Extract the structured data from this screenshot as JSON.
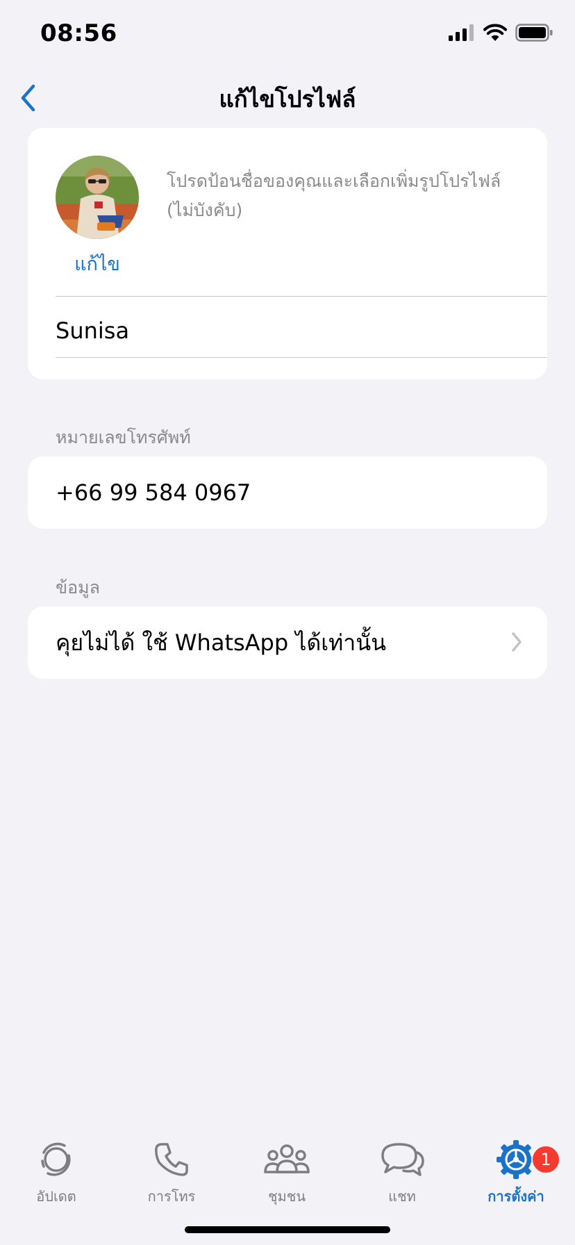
{
  "status_bar": {
    "time": "08:56",
    "battery_icon": "battery-full-icon",
    "wifi_icon": "wifi-icon",
    "signal_icon": "cellular-signal-icon"
  },
  "nav": {
    "title": "แก้ไขโปรไฟล์",
    "back_icon": "chevron-left-icon"
  },
  "profile": {
    "edit_label": "แก้ไข",
    "hint": "โปรดป้อนชื่อของคุณและเลือกเพิ่มรูปโปรไฟล์ (ไม่บังคับ)",
    "name": "Sunisa"
  },
  "phone": {
    "section_label": "หมายเลขโทรศัพท์",
    "value": "+66 99 584 0967"
  },
  "about": {
    "section_label": "ข้อมูล",
    "value": "คุยไม่ได้ ใช้ WhatsApp ได้เท่านั้น"
  },
  "tabs": [
    {
      "label": "อัปเดต",
      "icon": "updates-icon",
      "active": false
    },
    {
      "label": "การโทร",
      "icon": "phone-icon",
      "active": false
    },
    {
      "label": "ชุมชน",
      "icon": "communities-icon",
      "active": false
    },
    {
      "label": "แชท",
      "icon": "chats-icon",
      "active": false
    },
    {
      "label": "การตั้งค่า",
      "icon": "settings-gear-icon",
      "active": true,
      "badge": "1"
    }
  ],
  "colors": {
    "accent": "#1A73C8",
    "badge": "#F53B30",
    "background": "#F2F2F7"
  }
}
